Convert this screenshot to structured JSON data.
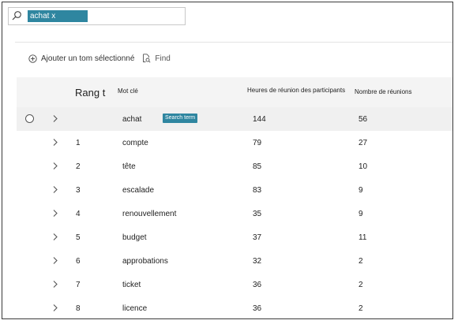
{
  "search": {
    "query": "achat x"
  },
  "toolbar": {
    "add_label": "Ajouter un tom sélectionné",
    "find_label": "Find"
  },
  "table": {
    "columns": {
      "rank": "Rang t",
      "keyword": "Mot clé",
      "hours": "Heures de réunion des participants",
      "count": "Nombre de réunions"
    },
    "search_badge": "Search term",
    "rows": [
      {
        "rank": "",
        "keyword": "achat",
        "hours": "144",
        "count": "56"
      },
      {
        "rank": "1",
        "keyword": "compte",
        "hours": "79",
        "count": "27"
      },
      {
        "rank": "2",
        "keyword": "tête",
        "hours": "85",
        "count": "10"
      },
      {
        "rank": "3",
        "keyword": "escalade",
        "hours": "83",
        "count": "9"
      },
      {
        "rank": "4",
        "keyword": "renouvellement",
        "hours": "35",
        "count": "9"
      },
      {
        "rank": "5",
        "keyword": "budget",
        "hours": "37",
        "count": "11"
      },
      {
        "rank": "6",
        "keyword": "approbations",
        "hours": "32",
        "count": "2"
      },
      {
        "rank": "7",
        "keyword": "ticket",
        "hours": "36",
        "count": "2"
      },
      {
        "rank": "8",
        "keyword": "licence",
        "hours": "36",
        "count": "2"
      }
    ]
  }
}
